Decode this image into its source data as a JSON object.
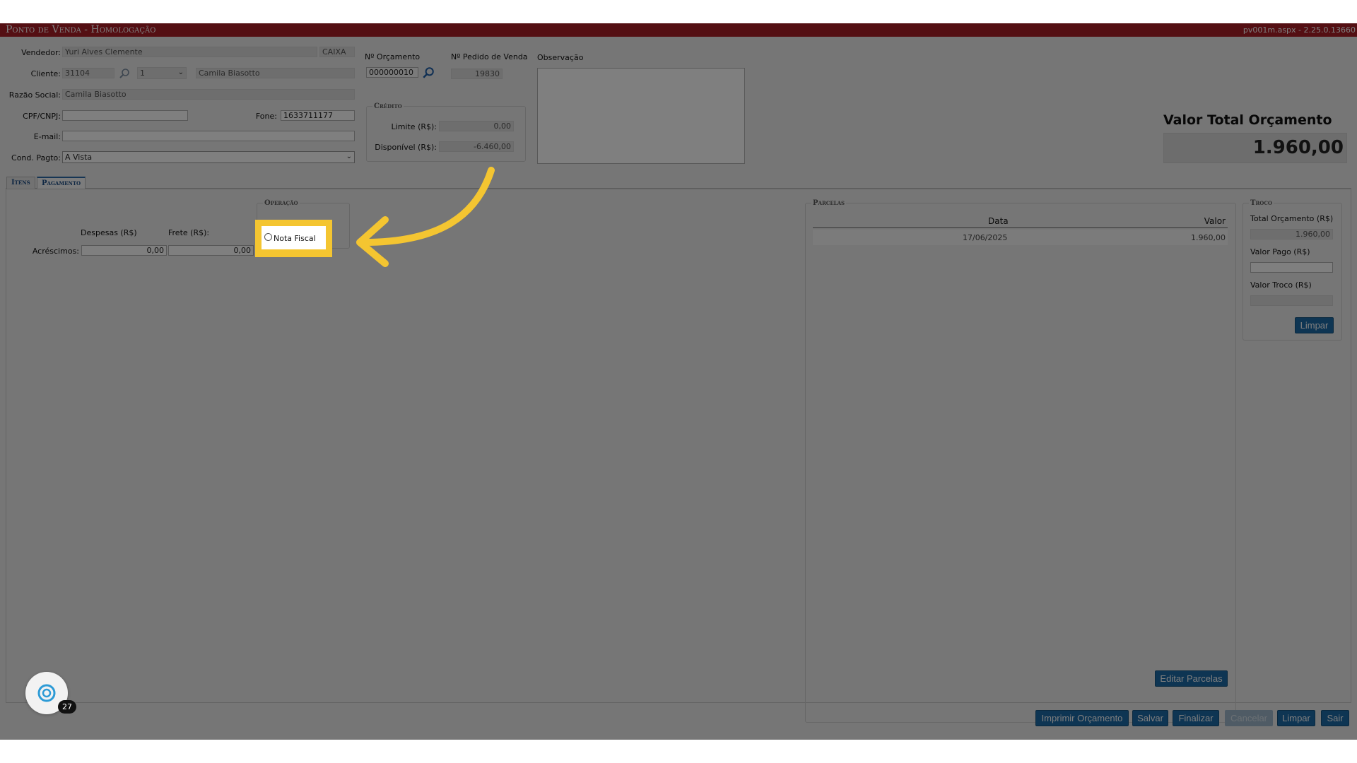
{
  "header": {
    "title": "Ponto de Venda  - Homologação",
    "version": "pv001m.aspx - 2.25.0.13660"
  },
  "form": {
    "vendedor_label": "Vendedor:",
    "vendedor_value": "Yuri Alves Clemente",
    "caixa_value": "CAIXA",
    "cliente_label": "Cliente:",
    "cliente_code": "31104",
    "cliente_select": "1",
    "cliente_name": "Camila Biasotto",
    "razao_label": "Razão Social:",
    "razao_value": "Camila Biasotto",
    "cpf_label": "CPF/CNPJ:",
    "cpf_value": "",
    "fone_label": "Fone:",
    "fone_value": "1633711177",
    "email_label": "E-mail:",
    "email_value": "",
    "cond_label": "Cond. Pagto:",
    "cond_value": "A Vista",
    "orcamento_label": "Nº Orçamento",
    "orcamento_value": "000000010",
    "pedido_label": "Nº Pedido de Venda",
    "pedido_value": "19830",
    "obs_label": "Observação",
    "obs_value": ""
  },
  "credito": {
    "legend": "Crédito",
    "limite_label": "Limite (R$):",
    "limite_value": "0,00",
    "disponivel_label": "Disponível (R$):",
    "disponivel_value": "-6.460,00"
  },
  "total": {
    "title": "Valor Total Orçamento",
    "value": "1.960,00"
  },
  "tabs": [
    {
      "label": "Itens"
    },
    {
      "label": "Pagamento"
    }
  ],
  "pagamento": {
    "despesas_label": "Despesas (R$)",
    "frete_label": "Frete (R$):",
    "acrescimos_label": "Acréscimos:",
    "despesas_value": "0,00",
    "frete_value": "0,00",
    "operacao_legend": "Operação",
    "operacao_option": "Nota Fiscal"
  },
  "parcelas": {
    "legend": "Parcelas",
    "columns": [
      "Data",
      "Valor"
    ],
    "rows": [
      {
        "data": "17/06/2025",
        "valor": "1.960,00"
      }
    ],
    "edit_button": "Editar Parcelas"
  },
  "troco": {
    "legend": "Troco",
    "total_label": "Total Orçamento (R$)",
    "total_value": "1.960,00",
    "pago_label": "Valor Pago (R$)",
    "pago_value": "",
    "troco_label": "Valor Troco (R$)",
    "troco_value": "",
    "limpar_button": "Limpar"
  },
  "footer_buttons": {
    "imprimir": "Imprimir Orçamento",
    "salvar": "Salvar",
    "finalizar": "Finalizar",
    "cancelar": "Cancelar",
    "limpar": "Limpar",
    "sair": "Sair"
  },
  "chat": {
    "badge": "27"
  },
  "colors": {
    "titlebar": "#a81e27",
    "button": "#1d6aa6",
    "highlight": "#f4c531"
  }
}
